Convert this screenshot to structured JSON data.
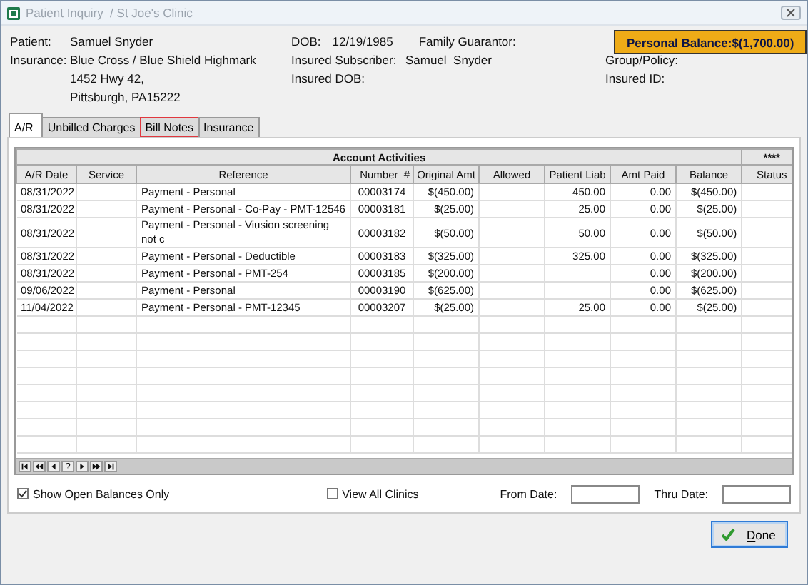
{
  "window": {
    "title": "Patient Inquiry  / St Joe's Clinic"
  },
  "header": {
    "patient": {
      "label": "Patient:",
      "value": "Samuel Snyder"
    },
    "dob": {
      "label": "DOB:",
      "value": "12/19/1985"
    },
    "family_guarantor": {
      "label": "Family Guarantor:"
    },
    "personal_balance": {
      "label": "Personal Balance:",
      "value": "$(1,700.00)"
    },
    "insurance": {
      "label": "Insurance:",
      "lines": [
        "Blue Cross / Blue Shield Highmark",
        "1452 Hwy 42,",
        "Pittsburgh, PA15222"
      ]
    },
    "insured_subscriber": {
      "label": "Insured Subscriber:",
      "value": "Samuel  Snyder"
    },
    "insured_dob": {
      "label": "Insured DOB:"
    },
    "group_policy": {
      "label": "Group/Policy:"
    },
    "insured_id": {
      "label": "Insured ID:"
    }
  },
  "tabs": [
    {
      "label": "A/R",
      "selected": true,
      "highlighted": false
    },
    {
      "label": "Unbilled Charges",
      "selected": false,
      "highlighted": false
    },
    {
      "label": "Bill Notes",
      "selected": false,
      "highlighted": true
    },
    {
      "label": "Insurance",
      "selected": false,
      "highlighted": false
    }
  ],
  "table": {
    "group_header": "Account Activities",
    "status_group_header": "****",
    "columns": [
      {
        "label": "A/R Date",
        "kind": "text"
      },
      {
        "label": "Service",
        "kind": "text"
      },
      {
        "label": "Reference",
        "kind": "wide"
      },
      {
        "label": "Number",
        "kind": "center",
        "sort_mark": "#"
      },
      {
        "label": "Original Amt",
        "kind": "amount"
      },
      {
        "label": "Allowed",
        "kind": "amount"
      },
      {
        "label": "Patient Liab",
        "kind": "amount"
      },
      {
        "label": "Amt Paid",
        "kind": "amount"
      },
      {
        "label": "Balance",
        "kind": "amount"
      },
      {
        "label": "Status",
        "kind": "text"
      }
    ],
    "rows": [
      [
        "08/31/2022",
        null,
        "Payment - Personal",
        "00003174",
        "$(450.00)",
        null,
        "450.00",
        "0.00",
        "$(450.00)",
        null
      ],
      [
        "08/31/2022",
        null,
        "Payment - Personal - Co-Pay - PMT-12546",
        "00003181",
        "$(25.00)",
        null,
        "25.00",
        "0.00",
        "$(25.00)",
        null
      ],
      [
        "08/31/2022",
        null,
        "Payment - Personal - Viusion screening not c",
        "00003182",
        "$(50.00)",
        null,
        "50.00",
        "0.00",
        "$(50.00)",
        null
      ],
      [
        "08/31/2022",
        null,
        "Payment - Personal - Deductible",
        "00003183",
        "$(325.00)",
        null,
        "325.00",
        "0.00",
        "$(325.00)",
        null
      ],
      [
        "08/31/2022",
        null,
        "Payment - Personal - PMT-254",
        "00003185",
        "$(200.00)",
        null,
        null,
        "0.00",
        "$(200.00)",
        null
      ],
      [
        "09/06/2022",
        null,
        "Payment - Personal",
        "00003190",
        "$(625.00)",
        null,
        null,
        "0.00",
        "$(625.00)",
        null
      ],
      [
        "11/04/2022",
        null,
        "Payment - Personal - PMT-12345",
        "00003207",
        "$(25.00)",
        null,
        "25.00",
        "0.00",
        "$(25.00)",
        null
      ]
    ]
  },
  "navigator": [
    {
      "kind": "first"
    },
    {
      "kind": "prev_page"
    },
    {
      "kind": "prev"
    },
    {
      "kind": "help",
      "label": "?"
    },
    {
      "kind": "next"
    },
    {
      "kind": "next_page"
    },
    {
      "kind": "last"
    }
  ],
  "filters": {
    "show_open_balances_only": {
      "label": "Show Open Balances Only",
      "checked": true
    },
    "view_all_clinics": {
      "label": "View All Clinics",
      "checked": false
    },
    "from_date": {
      "label": "From Date:"
    },
    "thru_date": {
      "label": "Thru Date:"
    }
  },
  "buttons": [
    {
      "label": "Done"
    }
  ]
}
